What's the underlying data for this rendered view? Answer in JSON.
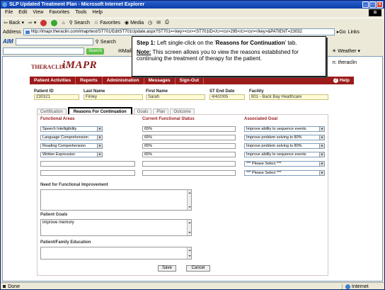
{
  "window": {
    "title": "SLP Updated Treatment Plan - Microsoft Internet Explorer"
  },
  "menu": [
    "File",
    "Edit",
    "View",
    "Favorites",
    "Tools",
    "Help"
  ],
  "toolbar": {
    "back": "Back",
    "search": "Search",
    "favorites": "Favorites",
    "media": "Media"
  },
  "address": {
    "label": "Address",
    "url": "http://imapr.theraclin.com/imaprtest/ST701/EditST701Update.aspx?ST701=<key><cv><ST701ID</c><cv>295</c><cv></key>&PATIENT=23032",
    "go": "Go",
    "links": "Links"
  },
  "aim": {
    "logo": "AIM",
    "search": "Search",
    "mail": "Mail",
    "weather": "Weather"
  },
  "app": {
    "logo_text": "THERACLIN",
    "logo_product": "iMAPR",
    "user": "n: theraclin",
    "nav": [
      "Patient Activities",
      "Reports",
      "Administration",
      "Messages",
      "Sign-Out"
    ],
    "help": "Help",
    "patient": {
      "labels": {
        "id": "Patient ID",
        "last": "Last Name",
        "first": "First Name",
        "end": "ST End Date",
        "facility": "Facility"
      },
      "values": {
        "id": "230321",
        "last": "Finley",
        "first": "Sarah",
        "end": "4/4/2005",
        "facility": "801 - Back Bay Healthcare"
      }
    },
    "tabs": [
      "Certification",
      "Reasons For Continuation",
      "Goals",
      "Plan",
      "Outcome"
    ],
    "form": {
      "headers": {
        "areas": "Functional Areas",
        "status": "Current Functional Status",
        "goal": "Associated Goal"
      },
      "rows": [
        {
          "area": "Speech Intelligibility",
          "status": "65%",
          "goal": "Improve ability to sequence events"
        },
        {
          "area": "Language Comprehension",
          "status": "65%",
          "goal": "Improve problem solving to 80%"
        },
        {
          "area": "Reading Comprehension",
          "status": "65%",
          "goal": "Improve problem solving to 80%"
        },
        {
          "area": "Written Expression",
          "status": "65%",
          "goal": "Improve ability to sequence events"
        },
        {
          "area": "",
          "status": "",
          "goal": "*** Please Select ***"
        },
        {
          "area": "",
          "status": "",
          "goal": "*** Please Select ***"
        }
      ],
      "need_label": "Need for Functional Improvement",
      "need_value": "",
      "goals_label": "Patient Goals",
      "goals_value": "improve memory",
      "education_label": "Patient/Family Education",
      "education_value": "",
      "save": "Save",
      "cancel": "Cancel"
    }
  },
  "callout": {
    "step_prefix": "Step 1:",
    "step_text": " Left single-click on the '",
    "step_target": "Reasons for Continuation",
    "step_suffix": "' tab.",
    "note_label": "Note:",
    "note_text": " This screen allows you to view the reasons established for continuing the treatment of therapy for the patient."
  },
  "status": {
    "left": "Done",
    "zone": "Internet"
  }
}
